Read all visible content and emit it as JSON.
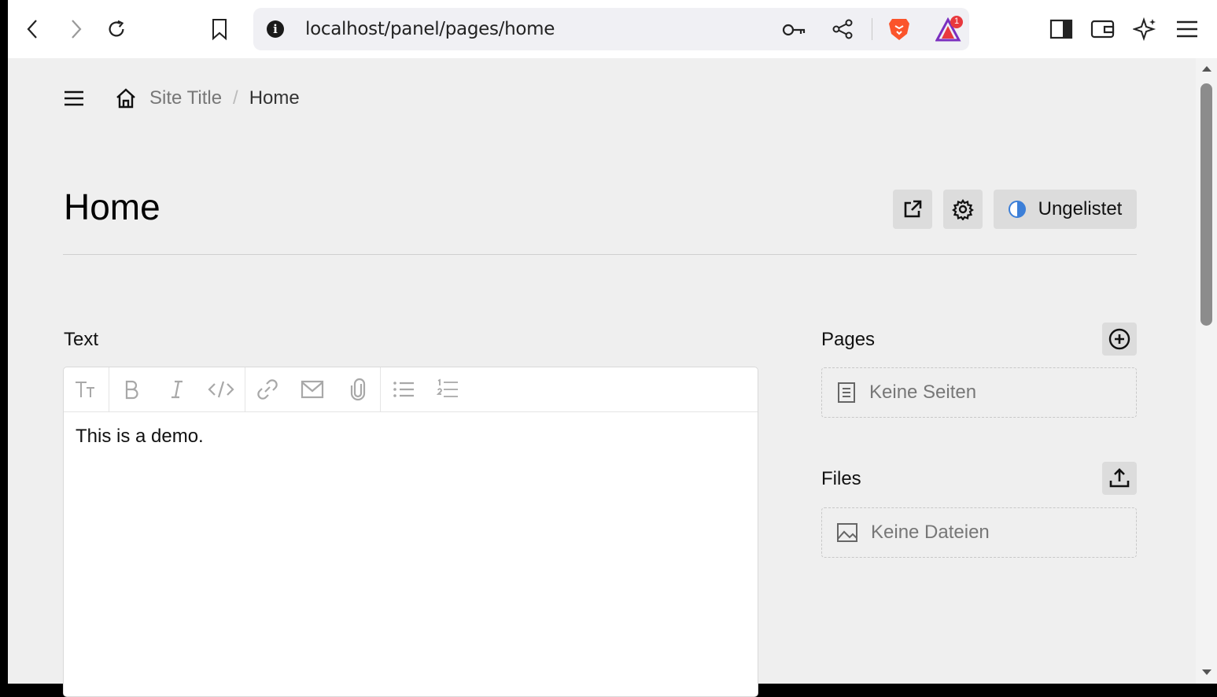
{
  "browser": {
    "url": "localhost/panel/pages/home",
    "notification_count": "1"
  },
  "breadcrumb": {
    "site_title": "Site Title",
    "separator": "/",
    "current": "Home"
  },
  "header": {
    "title": "Home",
    "status_label": "Ungelistet"
  },
  "fields": {
    "text": {
      "label": "Text",
      "content": "This is a demo."
    },
    "pages": {
      "label": "Pages",
      "empty_text": "Keine Seiten"
    },
    "files": {
      "label": "Files",
      "empty_text": "Keine Dateien"
    }
  },
  "colors": {
    "page_background": "#efefef",
    "button_background": "#dcdcdc",
    "status_blue": "#3c7fd8",
    "brave_orange": "#fb542b"
  }
}
